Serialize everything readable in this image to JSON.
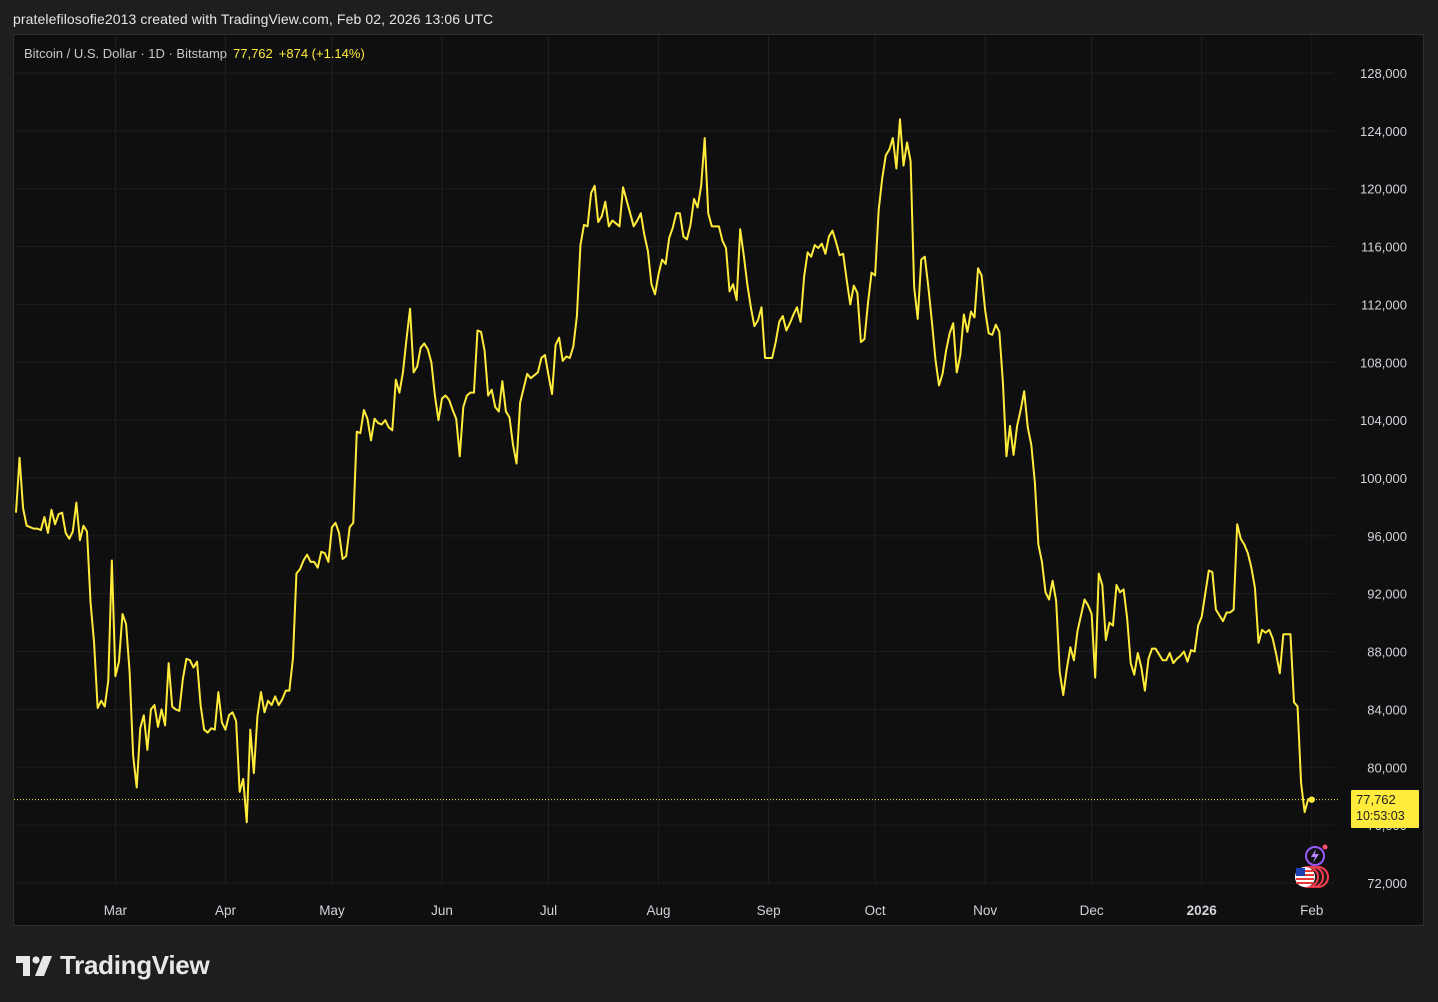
{
  "caption": "pratelefilosofie2013 created with TradingView.com, Feb 02, 2026 13:06 UTC",
  "legend": {
    "symbol": "Bitcoin / U.S. Dollar · 1D · Bitstamp",
    "price": "77,762",
    "change": "+874 (+1.14%)"
  },
  "last_price": {
    "value": "77,762",
    "countdown": "10:53:03"
  },
  "brand": "TradingView",
  "colors": {
    "line": "#ffeb3b",
    "background": "#0f0f0f",
    "grid": "#1f1f1f",
    "axis_text": "#d1d4dc"
  },
  "icons": [
    "lightning-icon",
    "us-flag-icon"
  ],
  "chart_data": {
    "type": "line",
    "title": "Bitcoin / U.S. Dollar · 1D · Bitstamp",
    "xlabel": "",
    "ylabel": "",
    "ylim": [
      70000,
      130000
    ],
    "y_ticks": [
      72000,
      76000,
      80000,
      84000,
      88000,
      92000,
      96000,
      100000,
      104000,
      108000,
      112000,
      116000,
      120000,
      124000,
      128000
    ],
    "y_tick_labels": [
      "72,000",
      "76,000",
      "80,000",
      "84,000",
      "88,000",
      "92,000",
      "96,000",
      "100,000",
      "104,000",
      "108,000",
      "112,000",
      "116,000",
      "120,000",
      "124,000",
      "128,000"
    ],
    "x_ticks": [
      {
        "label": "Mar",
        "date": "2025-03-01"
      },
      {
        "label": "Apr",
        "date": "2025-04-01"
      },
      {
        "label": "May",
        "date": "2025-05-01"
      },
      {
        "label": "Jun",
        "date": "2025-06-01"
      },
      {
        "label": "Jul",
        "date": "2025-07-01"
      },
      {
        "label": "Aug",
        "date": "2025-08-01"
      },
      {
        "label": "Sep",
        "date": "2025-09-01"
      },
      {
        "label": "Oct",
        "date": "2025-10-01"
      },
      {
        "label": "Nov",
        "date": "2025-11-01"
      },
      {
        "label": "Dec",
        "date": "2025-12-01"
      },
      {
        "label": "2026",
        "date": "2026-01-01",
        "bold": true
      },
      {
        "label": "Feb",
        "date": "2026-02-01"
      }
    ],
    "grid": true,
    "legend": "top-left",
    "series": [
      {
        "x_start": "2025-02-01",
        "interval": "1D",
        "values": [
          97600,
          101400,
          97900,
          96700,
          96600,
          96500,
          96500,
          96400,
          97300,
          96200,
          97800,
          96800,
          97500,
          97600,
          96200,
          95800,
          96300,
          98300,
          95700,
          96700,
          96300,
          91400,
          88600,
          84100,
          84600,
          84200,
          86000,
          94300,
          86300,
          87300,
          90600,
          89900,
          86600,
          80800,
          78600,
          82700,
          83600,
          81200,
          84000,
          84300,
          82800,
          84000,
          82900,
          87200,
          84200,
          84000,
          83900,
          86100,
          87500,
          87400,
          86900,
          87300,
          84300,
          82600,
          82400,
          82700,
          82600,
          85200,
          83100,
          82600,
          83600,
          83800,
          83200,
          78300,
          79200,
          76200,
          82600,
          79600,
          83500,
          85200,
          83800,
          84600,
          84300,
          84900,
          84300,
          84700,
          85300,
          85300,
          87500,
          93400,
          93700,
          94300,
          94700,
          94200,
          94200,
          93800,
          94900,
          94800,
          94200,
          96600,
          96900,
          96200,
          94400,
          94600,
          96600,
          96900,
          103200,
          103100,
          104700,
          104100,
          102600,
          104100,
          103800,
          103700,
          104000,
          103500,
          103300,
          106800,
          105900,
          107300,
          109600,
          111700,
          107300,
          107700,
          109000,
          109300,
          108900,
          108000,
          105700,
          104000,
          105500,
          105700,
          105400,
          104700,
          104100,
          101500,
          104900,
          105700,
          105900,
          105900,
          110200,
          110100,
          108800,
          105700,
          106100,
          104900,
          104600,
          106700,
          104600,
          104200,
          102300,
          101000,
          105200,
          106200,
          107200,
          106900,
          107100,
          107300,
          108300,
          108500,
          107100,
          105800,
          109200,
          109700,
          108100,
          108400,
          108300,
          109100,
          111200,
          116100,
          117500,
          117400,
          119700,
          120200,
          117700,
          118100,
          119100,
          117400,
          117800,
          117600,
          117400,
          120100,
          119200,
          118300,
          117400,
          117800,
          118300,
          116800,
          115700,
          113400,
          112700,
          114100,
          115100,
          114800,
          116600,
          117300,
          118300,
          118300,
          116700,
          116500,
          117500,
          119300,
          118700,
          120200,
          123500,
          118300,
          117400,
          117400,
          117400,
          116400,
          115900,
          112900,
          113400,
          112300,
          117200,
          115400,
          113400,
          111800,
          110500,
          110900,
          111800,
          108300,
          108300,
          108300,
          109400,
          110800,
          111200,
          110200,
          110700,
          111300,
          111800,
          110800,
          113900,
          115600,
          115300,
          116100,
          115900,
          116200,
          115500,
          116700,
          117100,
          116300,
          115400,
          115500,
          113700,
          112000,
          113300,
          112800,
          109400,
          109600,
          112100,
          114200,
          114000,
          118500,
          120700,
          122300,
          122700,
          123500,
          121400,
          124800,
          121600,
          123200,
          121900,
          113200,
          111000,
          115100,
          115300,
          113200,
          110800,
          108200,
          106400,
          107200,
          108800,
          110000,
          110700,
          107300,
          108500,
          111300,
          110100,
          111500,
          111100,
          114500,
          114000,
          111600,
          110000,
          109900,
          110600,
          110100,
          106600,
          101500,
          103600,
          101600,
          103600,
          104700,
          106000,
          103500,
          102300,
          99700,
          95400,
          94200,
          92100,
          91600,
          92900,
          91500,
          86600,
          85000,
          86800,
          88300,
          87400,
          89400,
          90500,
          91600,
          91200,
          90600,
          86200,
          93400,
          92600,
          88800,
          90000,
          89800,
          92600,
          92100,
          92300,
          90300,
          87200,
          86400,
          87900,
          86900,
          85300,
          87500,
          88200,
          88200,
          87800,
          87400,
          87400,
          87900,
          87200,
          87500,
          87700,
          88000,
          87300,
          88100,
          88000,
          89800,
          90400,
          92000,
          93600,
          93500,
          90900,
          90500,
          90100,
          90700,
          90700,
          90900,
          96800,
          95800,
          95400,
          94800,
          93800,
          92400,
          88600,
          89500,
          89300,
          89500,
          88900,
          87800,
          86500,
          89200,
          89200,
          89200,
          84500,
          84200,
          78900,
          76900,
          77800,
          77762
        ]
      }
    ]
  }
}
